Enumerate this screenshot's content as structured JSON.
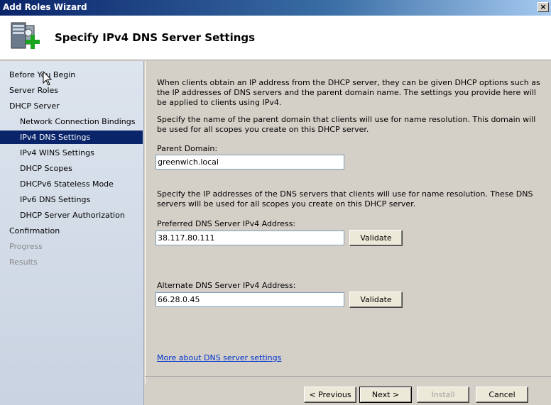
{
  "window": {
    "title": "Add Roles Wizard",
    "close_glyph": "×"
  },
  "header": {
    "title": "Specify IPv4 DNS Server Settings",
    "icon": "server-add-icon"
  },
  "sidebar": {
    "items": [
      {
        "label": "Before You Begin",
        "level": "top",
        "state": "normal"
      },
      {
        "label": "Server Roles",
        "level": "top",
        "state": "normal"
      },
      {
        "label": "DHCP Server",
        "level": "top",
        "state": "normal"
      },
      {
        "label": "Network Connection Bindings",
        "level": "sub",
        "state": "normal"
      },
      {
        "label": "IPv4 DNS Settings",
        "level": "sub",
        "state": "selected"
      },
      {
        "label": "IPv4 WINS Settings",
        "level": "sub",
        "state": "normal"
      },
      {
        "label": "DHCP Scopes",
        "level": "sub",
        "state": "normal"
      },
      {
        "label": "DHCPv6 Stateless Mode",
        "level": "sub",
        "state": "normal"
      },
      {
        "label": "IPv6 DNS Settings",
        "level": "sub",
        "state": "normal"
      },
      {
        "label": "DHCP Server Authorization",
        "level": "sub",
        "state": "normal"
      },
      {
        "label": "Confirmation",
        "level": "top",
        "state": "normal"
      },
      {
        "label": "Progress",
        "level": "top",
        "state": "disabled"
      },
      {
        "label": "Results",
        "level": "top",
        "state": "disabled"
      }
    ]
  },
  "main": {
    "intro": "When clients obtain an IP address from the DHCP server, they can be given DHCP options such as the IP addresses of DNS servers and the parent domain name. The settings you provide here will be applied to clients using IPv4.",
    "domain_desc": "Specify the name of the parent domain that clients will use for name resolution. This domain will be used for all scopes you create on this DHCP server.",
    "parent_domain_label": "Parent Domain:",
    "parent_domain_value": "greenwich.local",
    "dns_desc": "Specify the IP addresses of the DNS servers that clients will use for name resolution. These DNS servers will be used for all scopes you create on this DHCP server.",
    "preferred_label": "Preferred DNS Server IPv4 Address:",
    "preferred_value": "38.117.80.111",
    "alternate_label": "Alternate DNS Server IPv4 Address:",
    "alternate_value": "66.28.0.45",
    "validate_label": "Validate",
    "more_link": "More about DNS server settings"
  },
  "footer": {
    "previous": "< Previous",
    "next": "Next >",
    "install": "Install",
    "cancel": "Cancel"
  }
}
